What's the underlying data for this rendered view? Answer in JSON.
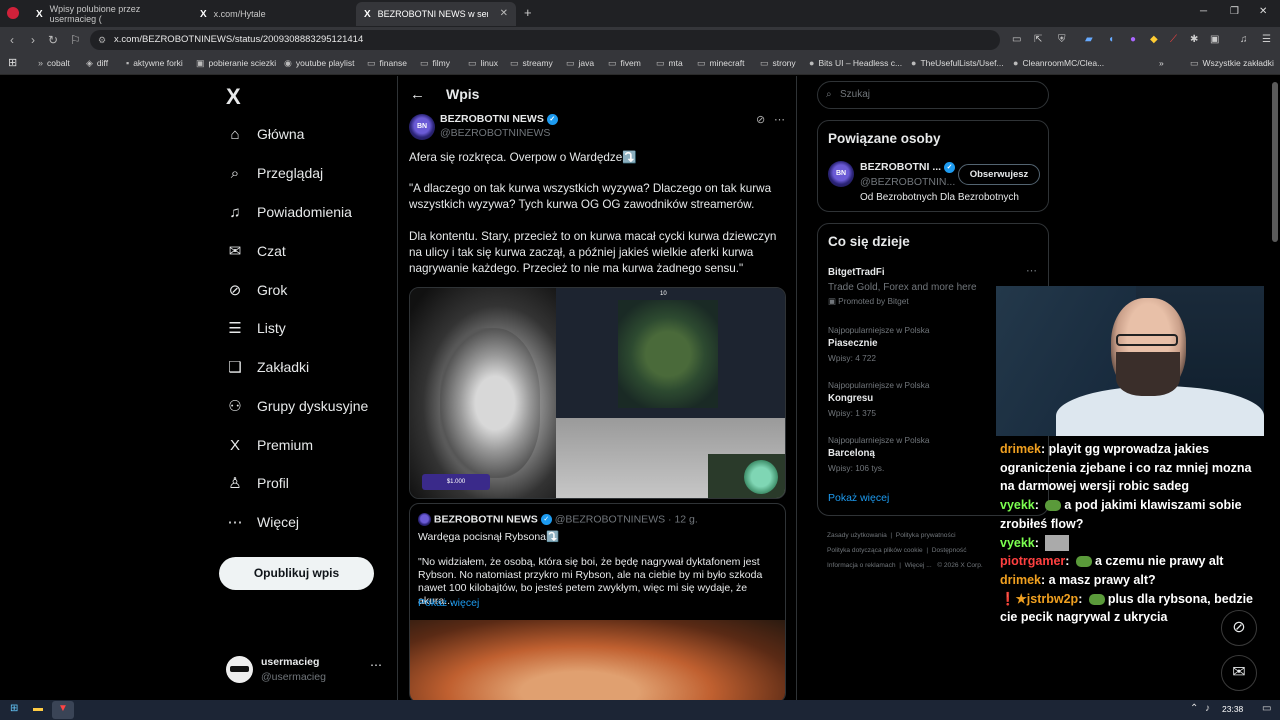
{
  "browser": {
    "tabs": [
      {
        "title": "Wpisy polubione przez usermacieg (",
        "icon": "X"
      },
      {
        "title": "x.com/Hytale",
        "icon": "X"
      },
      {
        "title": "BEZROBOTNI NEWS w serwis",
        "icon": "X"
      }
    ],
    "url": "x.com/BEZROBOTNINEWS/status/2009308883295121414",
    "bookmarks": [
      "cobalt",
      "diff",
      "aktywne forki",
      "pobieranie sciezki",
      "youtube playlist",
      "finanse",
      "filmy",
      "linux",
      "streamy",
      "java",
      "fivem",
      "mta",
      "minecraft",
      "strony",
      "Bits UI – Headless c...",
      "TheUsefulLists/Usef...",
      "CleanroomMC/Clea...",
      "Wszystkie zakładki"
    ],
    "new_tab_symbol": "+"
  },
  "nav": {
    "logo": "X",
    "items": [
      {
        "label": "Główna",
        "icon": "⌂"
      },
      {
        "label": "Przeglądaj",
        "icon": "⌕"
      },
      {
        "label": "Powiadomienia",
        "icon": "♫"
      },
      {
        "label": "Czat",
        "icon": "✉"
      },
      {
        "label": "Grok",
        "icon": "⊘"
      },
      {
        "label": "Listy",
        "icon": "☰"
      },
      {
        "label": "Zakładki",
        "icon": "❑"
      },
      {
        "label": "Grupy dyskusyjne",
        "icon": "⚇"
      },
      {
        "label": "Premium",
        "icon": "X"
      },
      {
        "label": "Profil",
        "icon": "♙"
      },
      {
        "label": "Więcej",
        "icon": "⋯"
      }
    ],
    "publish": "Opublikuj wpis",
    "user": {
      "name": "usermacieg",
      "handle": "@usermacieg"
    }
  },
  "post": {
    "header": "Wpis",
    "author": "BEZROBOTNI NEWS",
    "handle": "@BEZROBOTNINEWS",
    "avatar_text": "BN",
    "p1": "Afera się rozkręca. Overpow o Wardędze⤵️",
    "p2": "\"A dlaczego on tak kurwa wszystkich wyzywa? Dlaczego on tak kurwa wszystkich wyzywa? Tych kurwa OG OG zawodników streamerów.",
    "p3": "Dla kontentu. Stary, przecież to on kurwa macał cycki kurwa dziewczyn na ulicy i tak się kurwa zaczął, a później jakieś wielkie aferki kurwa nagrywanie każdego. Przecież to nie ma kurwa żadnego sensu.\"",
    "media": {
      "score": "10",
      "badge": "$1.000"
    },
    "quote": {
      "author": "BEZROBOTNI NEWS",
      "handle": "@BEZROBOTNINEWS",
      "time": "· 12 g.",
      "line1": "Wardęga pocisnął Rybsona⤵️",
      "body": "\"No widziałem, że osobą, która się boi, że będę nagrywał dyktafonem jest Rybson. No natomiast przykro mi Rybson, ale na ciebie by mi było szkoda nawet 100 kilobajtów, bo jesteś petem zwykłym, więc mi się wydaje, że akura...",
      "more": "Pokaż więcej"
    }
  },
  "right": {
    "search_placeholder": "Szukaj",
    "related": {
      "title": "Powiązane osoby",
      "name": "BEZROBOTNI ...",
      "handle": "@BEZROBOTNIN...",
      "follow": "Obserwujesz",
      "bio": "Od Bezrobotnych Dla Bezrobotnych"
    },
    "trending": {
      "title": "Co się dzieje",
      "ad": {
        "name": "BitgetTradFi",
        "desc": "Trade Gold, Forex and more here",
        "promo": "Promoted by Bitget"
      },
      "items": [
        {
          "context": "Najpopularniejsze w Polska",
          "name": "Piasecznie",
          "count": "Wpisy: 4 722"
        },
        {
          "context": "Najpopularniejsze w Polska",
          "name": "Kongresu",
          "count": "Wpisy: 1 375"
        },
        {
          "context": "Najpopularniejsze w Polska",
          "name": "Barceloną",
          "count": "Wpisy: 106 tys."
        }
      ],
      "more": "Pokaż więcej"
    },
    "footer": [
      "Zasady użytkowania",
      "Polityka prywatności",
      "Polityka dotycząca plików cookie",
      "Dostępność",
      "Informacja o reklamach",
      "Więcej ...",
      "© 2026 X Corp."
    ]
  },
  "chat": [
    {
      "user": "drimek",
      "color": "#f0a020",
      "text": "playit gg wprowadza jakies ograniczenia zjebane i co raz mniej mozna na darmowej wersji robic sadeg"
    },
    {
      "user": "vyekk",
      "color": "#7cff50",
      "text": "a pod jakimi klawiszami sobie zrobiłeś flow?",
      "emote": true
    },
    {
      "user": "vyekk",
      "color": "#7cff50",
      "text": "",
      "emote2": true
    },
    {
      "user": "piotrgamer",
      "color": "#ff4040",
      "text": "a czemu nie prawy alt",
      "emote": true
    },
    {
      "user": "drimek",
      "color": "#f0a020",
      "text": "a masz prawy alt?"
    },
    {
      "user": "jstrbw2p",
      "color": "#f0a020",
      "text": "plus dla rybsona, bedzie cie pecik nagrywal z ukrycia",
      "emote": true,
      "badge": "❗★"
    }
  ],
  "taskbar": {
    "clock": "23:38"
  }
}
